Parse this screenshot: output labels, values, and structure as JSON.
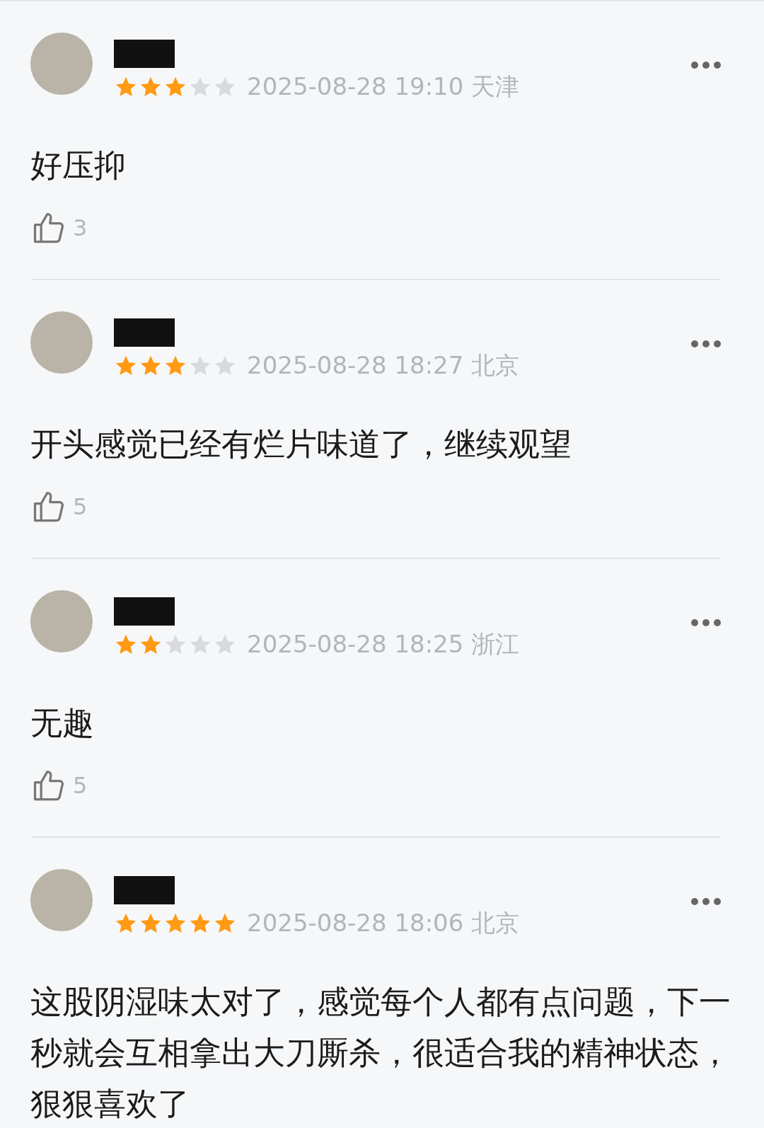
{
  "comments": [
    {
      "stars": 3,
      "date": "2025-08-28 19:10",
      "location": "天津",
      "text": "好压抑",
      "likes": "3"
    },
    {
      "stars": 3,
      "date": "2025-08-28 18:27",
      "location": "北京",
      "text": "开头感觉已经有烂片味道了，继续观望",
      "likes": "5"
    },
    {
      "stars": 2,
      "date": "2025-08-28 18:25",
      "location": "浙江",
      "text": "无趣",
      "likes": "5"
    },
    {
      "stars": 5,
      "date": "2025-08-28 18:06",
      "location": "北京",
      "text": "这股阴湿味太对了，感觉每个人都有点问题，下一秒就会互相拿出大刀厮杀，很适合我的精神状态，狠狠喜欢了"
    }
  ]
}
